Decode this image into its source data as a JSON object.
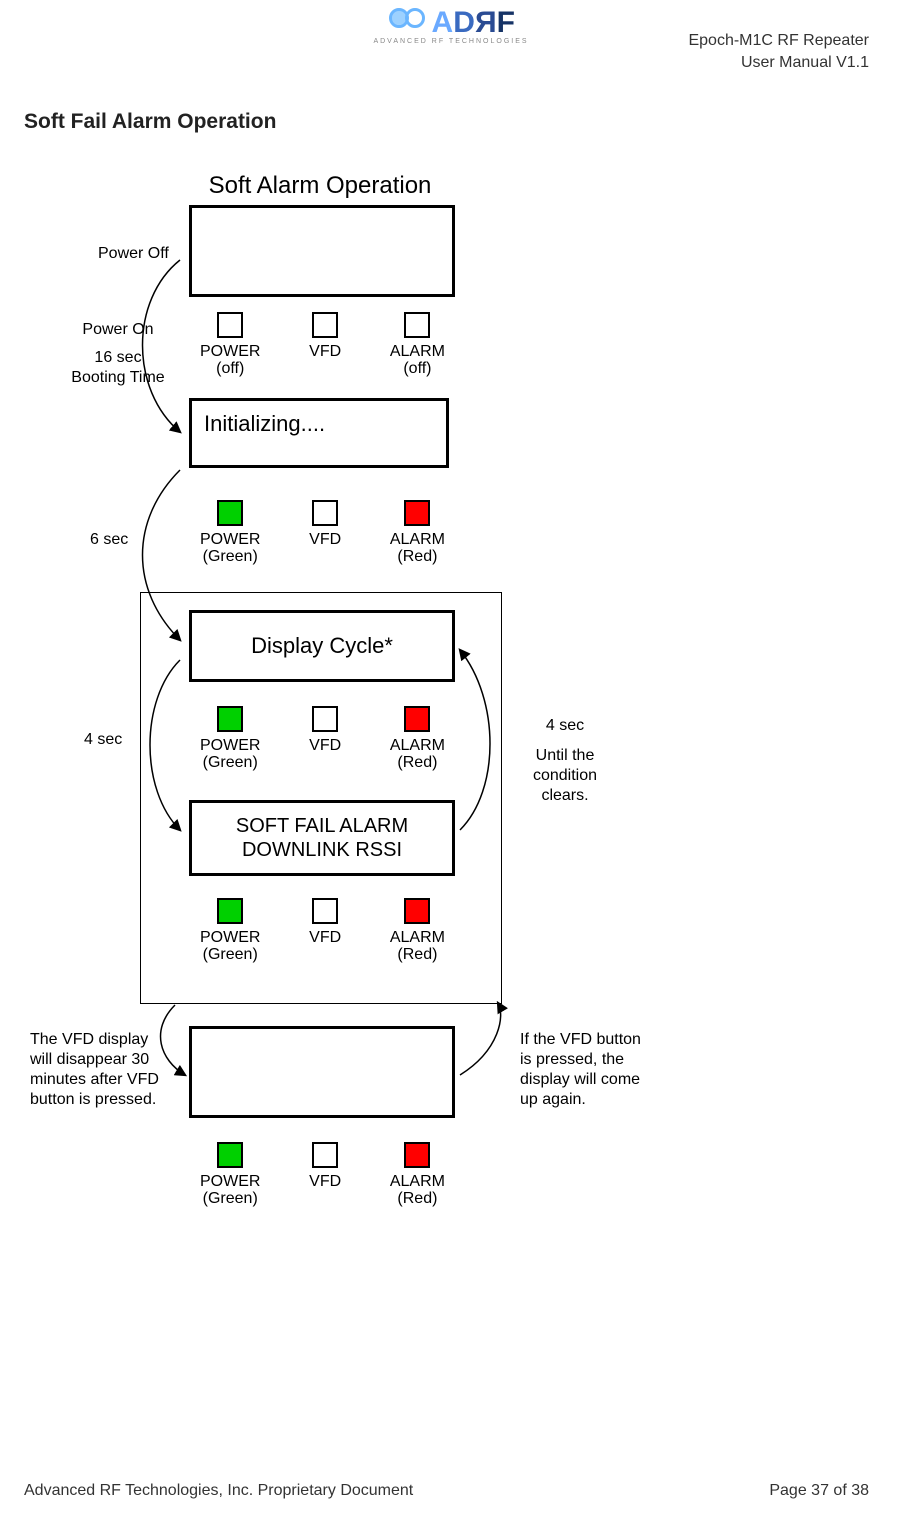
{
  "header": {
    "brand_text": "ADRF",
    "brand_sub": "ADVANCED RF TECHNOLOGIES",
    "doc_line1": "Epoch-M1C RF Repeater",
    "doc_line2": "User Manual V1.1"
  },
  "section_title": "Soft Fail Alarm Operation",
  "diagram": {
    "title": "Soft Alarm Operation",
    "labels": {
      "power_off": "Power Off",
      "power_on": "Power On",
      "booting_time_line1": "16 sec",
      "booting_time_line2": "Booting Time",
      "six_sec": "6 sec",
      "four_sec_left": "4 sec",
      "four_sec_right": "4 sec",
      "until_clears_line1": "Until the",
      "until_clears_line2": "condition",
      "until_clears_line3": "clears.",
      "bottom_left_l1": "The VFD display",
      "bottom_left_l2": "will disappear 30",
      "bottom_left_l3": "minutes after VFD",
      "bottom_left_l4": "button is pressed.",
      "bottom_right_l1": "If the VFD button",
      "bottom_right_l2": "is pressed,  the",
      "bottom_right_l3": "display will come",
      "bottom_right_l4": "up again."
    },
    "screens": {
      "s1": "",
      "s2": "Initializing....",
      "s3": "Display Cycle*",
      "s4a": "SOFT FAIL ALARM",
      "s4b": "DOWNLINK RSSI",
      "s5": ""
    },
    "led_labels": {
      "power": "POWER",
      "vfd": "VFD",
      "alarm": "ALARM",
      "off": "(off)",
      "green": "(Green)",
      "red": "(Red)"
    },
    "led_rows": [
      {
        "power": {
          "color": "white",
          "sub": "off"
        },
        "vfd": {
          "color": "white"
        },
        "alarm": {
          "color": "white",
          "sub": "off"
        }
      },
      {
        "power": {
          "color": "green",
          "sub": "green"
        },
        "vfd": {
          "color": "white"
        },
        "alarm": {
          "color": "red",
          "sub": "red"
        }
      },
      {
        "power": {
          "color": "green",
          "sub": "green"
        },
        "vfd": {
          "color": "white"
        },
        "alarm": {
          "color": "red",
          "sub": "red"
        }
      },
      {
        "power": {
          "color": "green",
          "sub": "green"
        },
        "vfd": {
          "color": "white"
        },
        "alarm": {
          "color": "red",
          "sub": "red"
        }
      },
      {
        "power": {
          "color": "green",
          "sub": "green"
        },
        "vfd": {
          "color": "white"
        },
        "alarm": {
          "color": "red",
          "sub": "red"
        }
      }
    ]
  },
  "footer": {
    "left": "Advanced RF Technologies, Inc. Proprietary Document",
    "right": "Page 37 of 38"
  }
}
